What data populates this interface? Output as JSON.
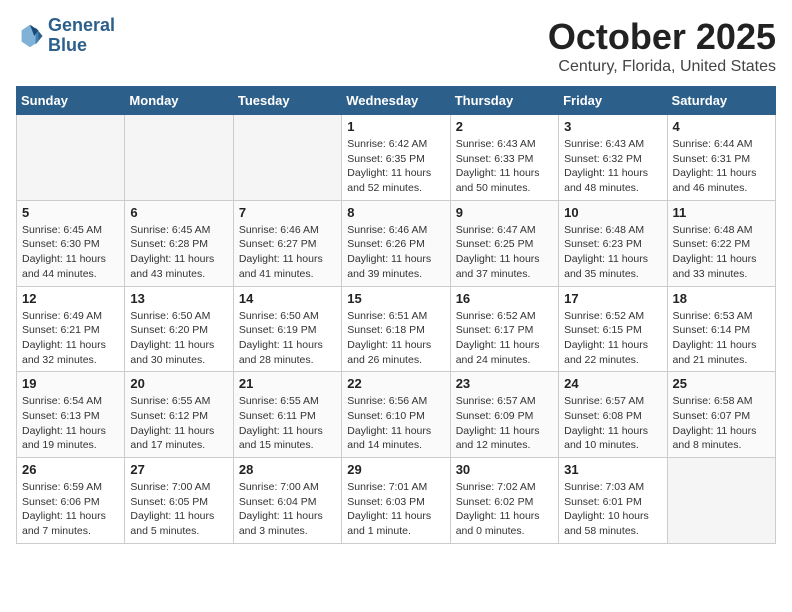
{
  "header": {
    "logo_line1": "General",
    "logo_line2": "Blue",
    "title": "October 2025",
    "subtitle": "Century, Florida, United States"
  },
  "weekdays": [
    "Sunday",
    "Monday",
    "Tuesday",
    "Wednesday",
    "Thursday",
    "Friday",
    "Saturday"
  ],
  "weeks": [
    [
      {
        "day": "",
        "empty": true
      },
      {
        "day": "",
        "empty": true
      },
      {
        "day": "",
        "empty": true
      },
      {
        "day": "1",
        "sunrise": "Sunrise: 6:42 AM",
        "sunset": "Sunset: 6:35 PM",
        "daylight": "Daylight: 11 hours and 52 minutes."
      },
      {
        "day": "2",
        "sunrise": "Sunrise: 6:43 AM",
        "sunset": "Sunset: 6:33 PM",
        "daylight": "Daylight: 11 hours and 50 minutes."
      },
      {
        "day": "3",
        "sunrise": "Sunrise: 6:43 AM",
        "sunset": "Sunset: 6:32 PM",
        "daylight": "Daylight: 11 hours and 48 minutes."
      },
      {
        "day": "4",
        "sunrise": "Sunrise: 6:44 AM",
        "sunset": "Sunset: 6:31 PM",
        "daylight": "Daylight: 11 hours and 46 minutes."
      }
    ],
    [
      {
        "day": "5",
        "sunrise": "Sunrise: 6:45 AM",
        "sunset": "Sunset: 6:30 PM",
        "daylight": "Daylight: 11 hours and 44 minutes."
      },
      {
        "day": "6",
        "sunrise": "Sunrise: 6:45 AM",
        "sunset": "Sunset: 6:28 PM",
        "daylight": "Daylight: 11 hours and 43 minutes."
      },
      {
        "day": "7",
        "sunrise": "Sunrise: 6:46 AM",
        "sunset": "Sunset: 6:27 PM",
        "daylight": "Daylight: 11 hours and 41 minutes."
      },
      {
        "day": "8",
        "sunrise": "Sunrise: 6:46 AM",
        "sunset": "Sunset: 6:26 PM",
        "daylight": "Daylight: 11 hours and 39 minutes."
      },
      {
        "day": "9",
        "sunrise": "Sunrise: 6:47 AM",
        "sunset": "Sunset: 6:25 PM",
        "daylight": "Daylight: 11 hours and 37 minutes."
      },
      {
        "day": "10",
        "sunrise": "Sunrise: 6:48 AM",
        "sunset": "Sunset: 6:23 PM",
        "daylight": "Daylight: 11 hours and 35 minutes."
      },
      {
        "day": "11",
        "sunrise": "Sunrise: 6:48 AM",
        "sunset": "Sunset: 6:22 PM",
        "daylight": "Daylight: 11 hours and 33 minutes."
      }
    ],
    [
      {
        "day": "12",
        "sunrise": "Sunrise: 6:49 AM",
        "sunset": "Sunset: 6:21 PM",
        "daylight": "Daylight: 11 hours and 32 minutes."
      },
      {
        "day": "13",
        "sunrise": "Sunrise: 6:50 AM",
        "sunset": "Sunset: 6:20 PM",
        "daylight": "Daylight: 11 hours and 30 minutes."
      },
      {
        "day": "14",
        "sunrise": "Sunrise: 6:50 AM",
        "sunset": "Sunset: 6:19 PM",
        "daylight": "Daylight: 11 hours and 28 minutes."
      },
      {
        "day": "15",
        "sunrise": "Sunrise: 6:51 AM",
        "sunset": "Sunset: 6:18 PM",
        "daylight": "Daylight: 11 hours and 26 minutes."
      },
      {
        "day": "16",
        "sunrise": "Sunrise: 6:52 AM",
        "sunset": "Sunset: 6:17 PM",
        "daylight": "Daylight: 11 hours and 24 minutes."
      },
      {
        "day": "17",
        "sunrise": "Sunrise: 6:52 AM",
        "sunset": "Sunset: 6:15 PM",
        "daylight": "Daylight: 11 hours and 22 minutes."
      },
      {
        "day": "18",
        "sunrise": "Sunrise: 6:53 AM",
        "sunset": "Sunset: 6:14 PM",
        "daylight": "Daylight: 11 hours and 21 minutes."
      }
    ],
    [
      {
        "day": "19",
        "sunrise": "Sunrise: 6:54 AM",
        "sunset": "Sunset: 6:13 PM",
        "daylight": "Daylight: 11 hours and 19 minutes."
      },
      {
        "day": "20",
        "sunrise": "Sunrise: 6:55 AM",
        "sunset": "Sunset: 6:12 PM",
        "daylight": "Daylight: 11 hours and 17 minutes."
      },
      {
        "day": "21",
        "sunrise": "Sunrise: 6:55 AM",
        "sunset": "Sunset: 6:11 PM",
        "daylight": "Daylight: 11 hours and 15 minutes."
      },
      {
        "day": "22",
        "sunrise": "Sunrise: 6:56 AM",
        "sunset": "Sunset: 6:10 PM",
        "daylight": "Daylight: 11 hours and 14 minutes."
      },
      {
        "day": "23",
        "sunrise": "Sunrise: 6:57 AM",
        "sunset": "Sunset: 6:09 PM",
        "daylight": "Daylight: 11 hours and 12 minutes."
      },
      {
        "day": "24",
        "sunrise": "Sunrise: 6:57 AM",
        "sunset": "Sunset: 6:08 PM",
        "daylight": "Daylight: 11 hours and 10 minutes."
      },
      {
        "day": "25",
        "sunrise": "Sunrise: 6:58 AM",
        "sunset": "Sunset: 6:07 PM",
        "daylight": "Daylight: 11 hours and 8 minutes."
      }
    ],
    [
      {
        "day": "26",
        "sunrise": "Sunrise: 6:59 AM",
        "sunset": "Sunset: 6:06 PM",
        "daylight": "Daylight: 11 hours and 7 minutes."
      },
      {
        "day": "27",
        "sunrise": "Sunrise: 7:00 AM",
        "sunset": "Sunset: 6:05 PM",
        "daylight": "Daylight: 11 hours and 5 minutes."
      },
      {
        "day": "28",
        "sunrise": "Sunrise: 7:00 AM",
        "sunset": "Sunset: 6:04 PM",
        "daylight": "Daylight: 11 hours and 3 minutes."
      },
      {
        "day": "29",
        "sunrise": "Sunrise: 7:01 AM",
        "sunset": "Sunset: 6:03 PM",
        "daylight": "Daylight: 11 hours and 1 minute."
      },
      {
        "day": "30",
        "sunrise": "Sunrise: 7:02 AM",
        "sunset": "Sunset: 6:02 PM",
        "daylight": "Daylight: 11 hours and 0 minutes."
      },
      {
        "day": "31",
        "sunrise": "Sunrise: 7:03 AM",
        "sunset": "Sunset: 6:01 PM",
        "daylight": "Daylight: 10 hours and 58 minutes."
      },
      {
        "day": "",
        "empty": true
      }
    ]
  ]
}
